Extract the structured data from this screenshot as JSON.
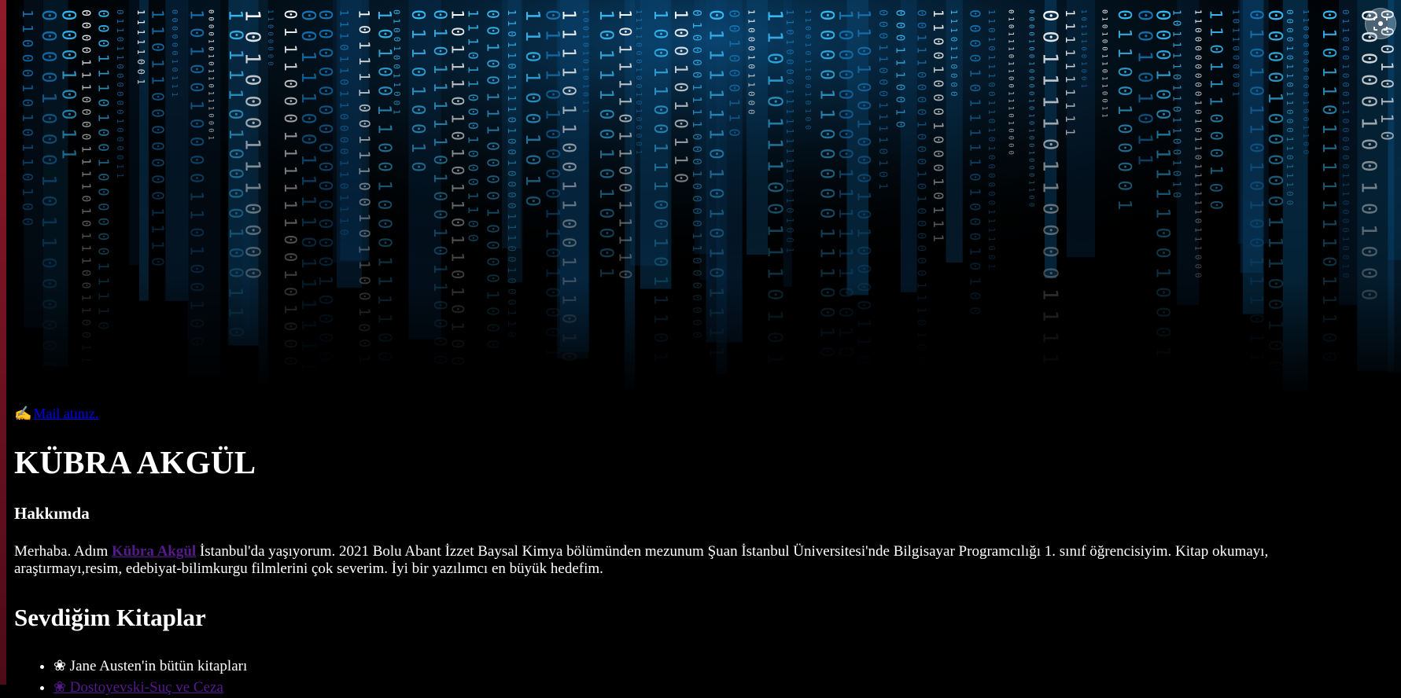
{
  "mail": {
    "icon": "writing-hand-icon",
    "label": "Mail atınız."
  },
  "header": {
    "name": "KÜBRA AKGÜL"
  },
  "about": {
    "heading": "Hakkımda",
    "prefix": "Merhaba. Adım ",
    "name_link": "Kübra Akgül",
    "text": " İstanbul'da yaşıyorum. 2021 Bolu Abant İzzet Baysal Kimya bölümünden mezunum Şuan İstanbul Üniversitesi'nde Bilgisayar Programcılığı 1. sınıf öğrencisiyim. Kitap okumayı, araştırmayı,resim, edebiyat-bilimkurgu filmlerini çok severim. İyi bir yazılımcı en büyük hedefim."
  },
  "books": {
    "heading": "Sevdiğim Kitaplar",
    "items": [
      {
        "label": "❀ Jane Austen'in bütün kitapları"
      },
      {
        "label": "❀ Dostoyevski-Suç ve Ceza"
      }
    ]
  },
  "colors": {
    "link": "#0000ee",
    "visited_link": "#551a8b",
    "accent_cyan": "#29b6f6"
  },
  "hero": {
    "icon": "binary-code-rain-image"
  }
}
